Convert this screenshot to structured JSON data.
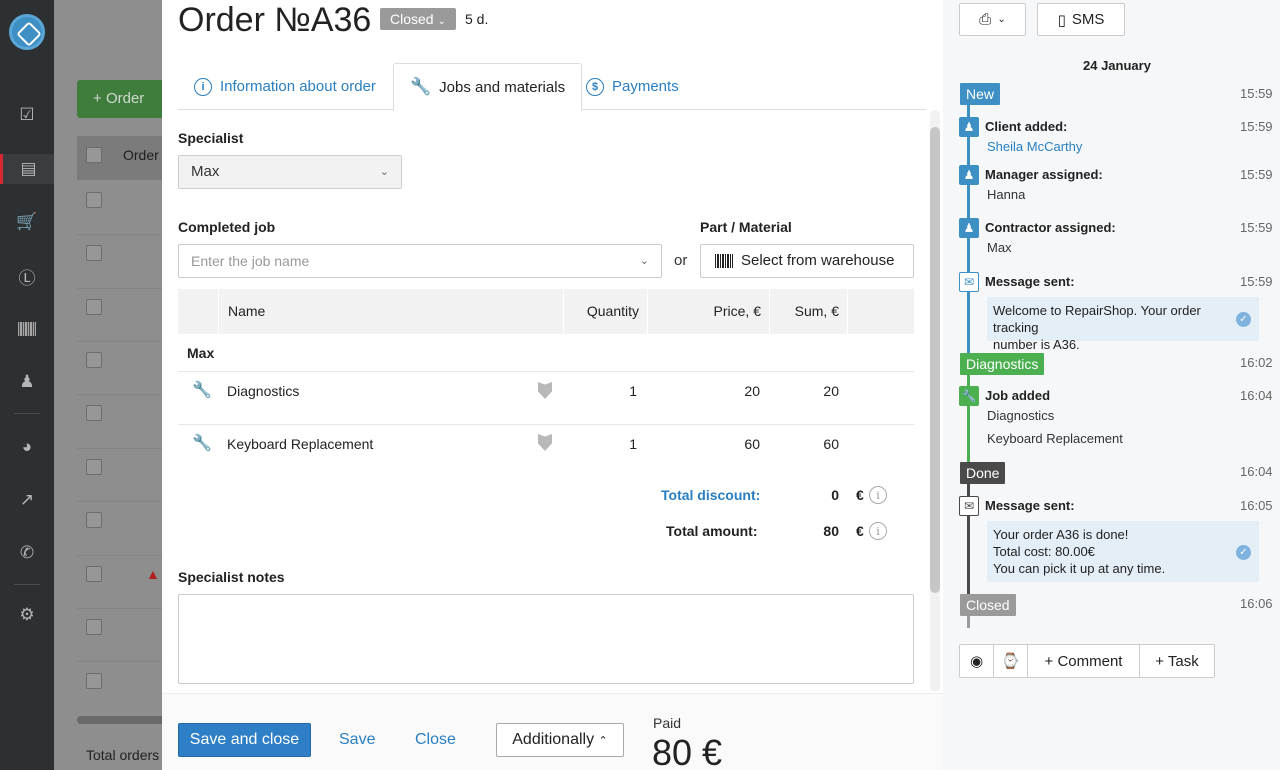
{
  "colors": {
    "accent": "#2f7fc6",
    "nav_bg": "#2d3033",
    "new_badge": "#3d8fc4",
    "diagnostics_badge": "#4caf50",
    "done_badge": "#4a4a4a",
    "closed_badge": "#9a9a9a"
  },
  "nav": {
    "icons": [
      "logo-icon",
      "clipboard-icon",
      "orders-icon",
      "cart-icon",
      "dollar-icon",
      "barcode-icon",
      "person-icon",
      "speedometer-icon",
      "chart-icon",
      "phone-icon",
      "gear-icon"
    ]
  },
  "background": {
    "new_order_label": "Order",
    "list_header": "Order",
    "total_label": "Total orders"
  },
  "order": {
    "title": "Order №A36",
    "status": "Closed",
    "age": "5 d."
  },
  "tabs": [
    {
      "label": "Information about order",
      "icon": "info-icon"
    },
    {
      "label": "Jobs and materials",
      "icon": "wrench-icon"
    },
    {
      "label": "Payments",
      "icon": "dollar-circle-icon"
    }
  ],
  "form": {
    "specialist_label": "Specialist",
    "specialist_value": "Max",
    "completed_job_label": "Completed job",
    "completed_job_placeholder": "Enter the job name",
    "or_text": "or",
    "part_label": "Part / Material",
    "warehouse_button": "Select from warehouse",
    "notes_label": "Specialist notes"
  },
  "table": {
    "columns": [
      "Name",
      "Quantity",
      "Price, €",
      "Sum, €"
    ],
    "group": "Max",
    "rows": [
      {
        "name": "Diagnostics",
        "quantity": "1",
        "price": "20",
        "sum": "20"
      },
      {
        "name": "Keyboard Replacement",
        "quantity": "1",
        "price": "60",
        "sum": "60"
      }
    ],
    "total_discount_label": "Total discount:",
    "total_discount_value": "0",
    "total_amount_label": "Total amount:",
    "total_amount_value": "80",
    "currency": "€"
  },
  "footer": {
    "save_close": "Save and close",
    "save": "Save",
    "close": "Close",
    "additionally": "Additionally",
    "paid_label": "Paid",
    "paid_value": "80 €"
  },
  "side": {
    "sms_label": "SMS",
    "date": "24 January",
    "events": {
      "new_badge": "New",
      "new_time": "15:59",
      "client_title": "Client added:",
      "client_name": "Sheila McCarthy",
      "client_time": "15:59",
      "manager_title": "Manager assigned:",
      "manager_name": "Hanna",
      "manager_time": "15:59",
      "contractor_title": "Contractor assigned:",
      "contractor_name": "Max",
      "contractor_time": "15:59",
      "msg1_title": "Message sent:",
      "msg1_time": "15:59",
      "msg1_line1": "Welcome to RepairShop. Your order tracking",
      "msg1_line2": "number is A36.",
      "diag_badge": "Diagnostics",
      "diag_time": "16:02",
      "job_title": "Job added",
      "job_time": "16:04",
      "job_item1": "Diagnostics",
      "job_item2": "Keyboard Replacement",
      "done_badge": "Done",
      "done_time": "16:04",
      "msg2_title": "Message sent:",
      "msg2_time": "16:05",
      "msg2_line1": "Your order A36 is done!",
      "msg2_line2": "Total cost: 80.00€",
      "msg2_line3": "You can pick it up at any time.",
      "closed_badge": "Closed",
      "closed_time": "16:06"
    },
    "actions": {
      "comment": "+ Comment",
      "task": "+ Task"
    }
  }
}
